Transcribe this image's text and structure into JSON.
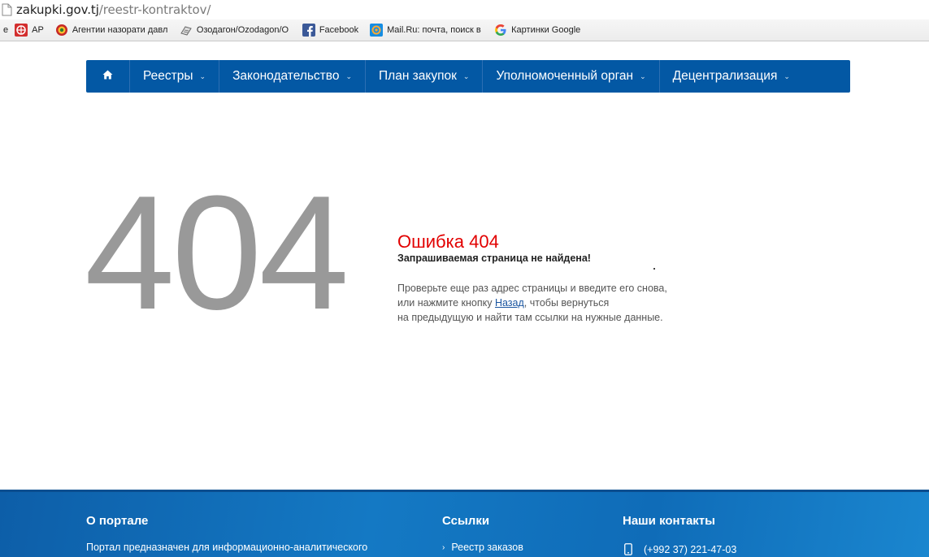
{
  "addressbar": {
    "host": "zakupki.gov.tj",
    "path": "/reestr-kontraktov/"
  },
  "bookmarks": [
    {
      "label": "e",
      "icon": "none"
    },
    {
      "label": "AP",
      "icon": "red-grid-icon"
    },
    {
      "label": "Агентии назорати давл",
      "icon": "emblem-icon"
    },
    {
      "label": "Озодагон/Ozodagon/O",
      "icon": "newspaper-icon"
    },
    {
      "label": "Facebook",
      "icon": "facebook-icon"
    },
    {
      "label": "Mail.Ru: почта, поиск в",
      "icon": "mailru-icon"
    },
    {
      "label": "Картинки Google",
      "icon": "google-icon"
    }
  ],
  "nav": {
    "home_icon": "home-icon",
    "items": [
      {
        "label": "Реестры"
      },
      {
        "label": "Законодательство"
      },
      {
        "label": "План закупок"
      },
      {
        "label": "Уполномоченный орган"
      },
      {
        "label": "Децентрализация"
      }
    ]
  },
  "error": {
    "code": "404",
    "title": "Ошибка 404",
    "subtitle": "Запрашиваемая страница не найдена!",
    "line1": "Проверьте еще раз адрес страницы и введите его снова,",
    "line2_before": "или нажмите кнопку ",
    "back_link": "Назад",
    "line2_after": ", чтобы вернуться",
    "line3": "на предыдущую и найти там ссылки на нужные данные."
  },
  "footer": {
    "about_title": "О портале",
    "about_text": "Портал предназначен для информационно-аналитического",
    "links_title": "Ссылки",
    "links": [
      {
        "label": "Реестр заказов"
      }
    ],
    "contacts_title": "Наши контакты",
    "phone": "(+992 37) 221-47-03"
  },
  "colors": {
    "nav_bg": "#0358a4",
    "error_red": "#e20000",
    "big_code_gray": "#999999",
    "footer_blue": "#1479c4"
  }
}
